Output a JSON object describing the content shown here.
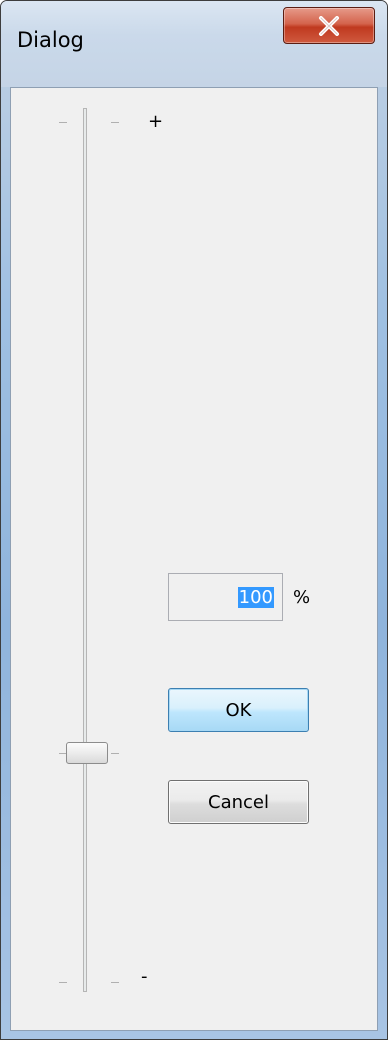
{
  "window": {
    "title": "Dialog",
    "close_icon": "close-x-icon"
  },
  "slider": {
    "top_label": "+",
    "bottom_label": "-",
    "value_fraction": 0.28
  },
  "zoom": {
    "value": "100",
    "unit": "%"
  },
  "buttons": {
    "ok_label": "OK",
    "cancel_label": "Cancel"
  },
  "colors": {
    "close_button": "#c0391f",
    "selection": "#3399ff",
    "ok_border": "#3c7fb1"
  }
}
